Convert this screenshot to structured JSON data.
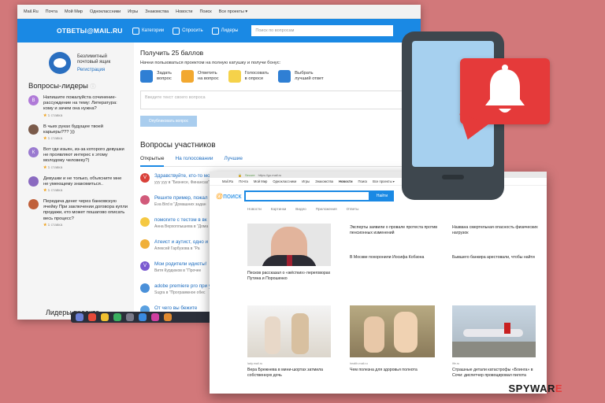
{
  "answers_window": {
    "portal_links": [
      "Mail.Ru",
      "Почта",
      "Мой Мир",
      "Одноклассники",
      "Игры",
      "Знакомства",
      "Новости",
      "Поиск",
      "Все проекты ▾"
    ],
    "logo": "ОТВЕТЫ@MAIL.RU",
    "header_buttons": [
      "Категории",
      "Спросить",
      "Лидеры"
    ],
    "search_placeholder": "Поиск по вопросам",
    "promo": {
      "line1": "Безлимитный",
      "line2": "почтовый ящик",
      "link": "Регистрация"
    },
    "leaders_title": "Вопросы-лидеры",
    "leader_questions": [
      {
        "avatar": "В",
        "text": "Напишите пожалуйста сочинение-рассуждение на тему: Литература: кому и зачем она нужна?",
        "meta": "1 ставка"
      },
      {
        "avatar": "",
        "text": "В чьих руках будущее твоей карьеры??? )))",
        "meta": "1 ставка"
      },
      {
        "avatar": "К",
        "text": "Вот где изьян, из-за которого девушки не проявляют интерес к этому молодому человеку?)",
        "meta": "1 ставка"
      },
      {
        "avatar": "",
        "text": "Девушки и не только, объясните мне не умеющему знакомиться..",
        "meta": "1 ставка"
      },
      {
        "avatar": "",
        "text": "Передача денег через банковскую ячейку При заключении договора купли продажи, кто может пошагово описать весь процесс?",
        "meta": "1 ставка"
      }
    ],
    "project_leaders_title": "Лидеры проекта",
    "bonus": {
      "title": "Получить 25 баллов",
      "subtitle": "Начни пользоваться проектом на полную катушку и получи бонус:",
      "tasks": [
        "Задать\nвопрос",
        "Ответить\nна вопрос",
        "Голосовать\nв опросе",
        "Выбрать\nлучший ответ"
      ]
    },
    "ask_placeholder": "Введите текст своего вопроса",
    "publish_button": "Опубликовать вопрос",
    "participants_title": "Вопросы участников",
    "tabs": [
      "Открытые",
      "На голосовании",
      "Лучшие"
    ],
    "main_questions": [
      {
        "avatar": "V",
        "title": "Здравствуйте, кто-то может расшифровать мезозинский почерк? (ФОТО)",
        "by": "ууу ууу в \"Бизнесе, Финансах\""
      },
      {
        "avatar": "",
        "title": "Решите пример, пожал",
        "by": "Eva Bird в \"Домашних задан"
      },
      {
        "avatar": "",
        "title": "помогите с тестом в вк",
        "by": "Анна Верхоплышева в \"Дома"
      },
      {
        "avatar": "",
        "title": "Атеист и аутист, одно и",
        "by": "Алексей Гарбузова в \"Ра"
      },
      {
        "avatar": "V",
        "title": "Мои родители идиоты!",
        "by": "Витя Курдюков в \"Прочее"
      },
      {
        "avatar": "",
        "title": "adobe premiere pro при убра",
        "by": "Sugra в \"Программное обес"
      },
      {
        "avatar": "",
        "title": "От чего вы бежите",
        "by": ""
      }
    ]
  },
  "search_window": {
    "url": "https://go.mail.ru",
    "secure_label": "Secure",
    "portal_links": [
      "Mail.Ru",
      "Почта",
      "Мой Мир",
      "Одноклассники",
      "Игры",
      "Знакомства",
      "Новости",
      "Поиск",
      "Все проекты ▾"
    ],
    "logo_mark": "@",
    "logo_text": "поиск",
    "search_button": "Найти",
    "search_tabs": [
      "Новости",
      "Картинки",
      "Видео",
      "Приложения",
      "Ответы"
    ],
    "news_right": [
      "Эксперты заявили о провале протеста против пенсионных изменений",
      "Названа смертельная опасность физических нагрузок",
      "В Москве похоронили Иосифа Кобзона",
      "Бывшего банкира арестовали, чтобы найти"
    ],
    "news_feature": "Песков рассказал о «жёстких» переговорах Путина и Порошенко",
    "cards": [
      {
        "source": "lady.mail.ru",
        "caption": "Вера Брежнева в мини-шортах затмила собственную дочь"
      },
      {
        "source": "health.mail.ru",
        "caption": "Чем полезна для здоровья полнота"
      },
      {
        "source": "life.ru",
        "caption": "Страшные детали катастрофы «Боинга» в Сочи: диспетчер провоцировал пилота"
      }
    ]
  },
  "watermark": {
    "prefix": "2",
    "text": "SPYWAR"
  },
  "colors": {
    "background": "#d2787a",
    "mailru_blue": "#1a89e4",
    "alert_red": "#e53a3a",
    "phone_body": "#3e474e",
    "phone_screen": "#a6d0ef"
  }
}
